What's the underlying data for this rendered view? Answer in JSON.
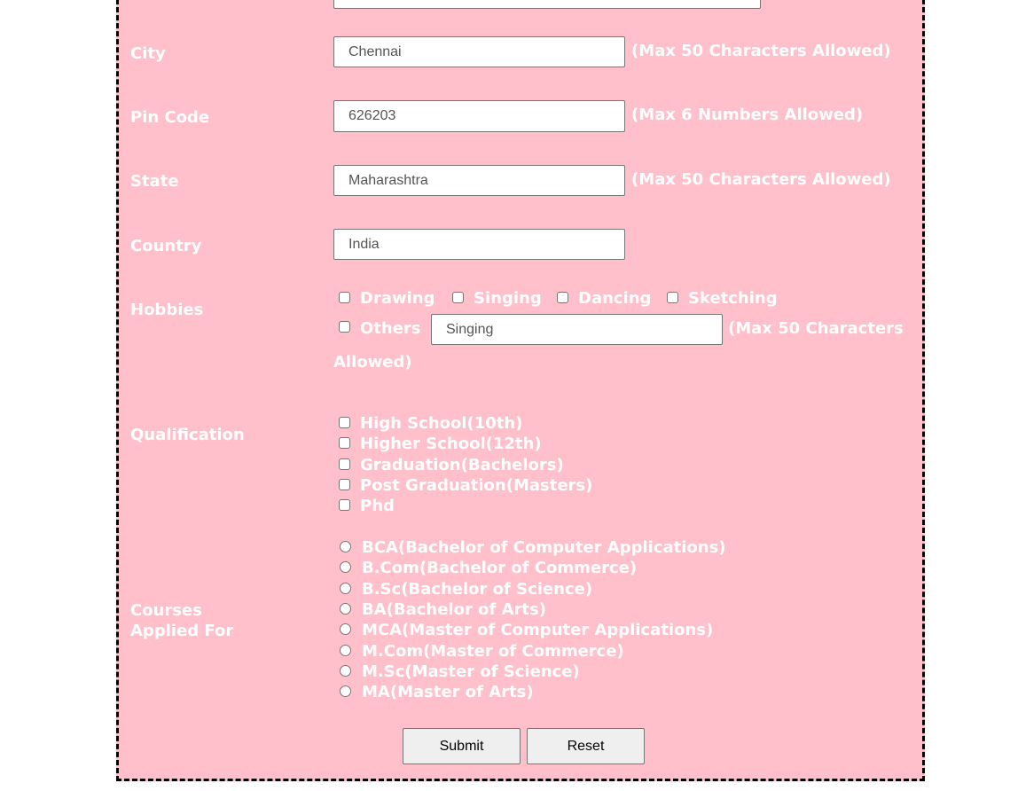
{
  "fields": {
    "city": {
      "label": "City",
      "value": "Chennai",
      "hint": "(Max 50 Characters Allowed)"
    },
    "pin": {
      "label": "Pin Code",
      "value": "626203",
      "hint": "(Max 6 Numbers Allowed)"
    },
    "state": {
      "label": "State",
      "value": "Maharashtra",
      "hint": "(Max 50 Characters Allowed)"
    },
    "country": {
      "label": "Country",
      "value": "India"
    }
  },
  "hobbies": {
    "label": "Hobbies",
    "options": [
      "Drawing",
      "Singing",
      "Dancing",
      "Sketching",
      "Others"
    ],
    "other_value": "Singing",
    "hint_part1": "(Max 50 Characters",
    "hint_part2": "Allowed)"
  },
  "qualification": {
    "label": "Qualification",
    "options": [
      "High School(10th)",
      "Higher School(12th)",
      "Graduation(Bachelors)",
      "Post Graduation(Masters)",
      "Phd"
    ]
  },
  "courses": {
    "label_line1": "Courses",
    "label_line2": "Applied For",
    "options": [
      "BCA(Bachelor of Computer Applications)",
      "B.Com(Bachelor of Commerce)",
      "B.Sc(Bachelor of Science)",
      "BA(Bachelor of Arts)",
      "MCA(Master of Computer Applications)",
      "M.Com(Master of Commerce)",
      "M.Sc(Master of Science)",
      "MA(Master of Arts)"
    ]
  },
  "buttons": {
    "submit": "Submit",
    "reset": "Reset"
  },
  "colors": {
    "background": "#ffc0cb",
    "text": "#ffffff"
  }
}
